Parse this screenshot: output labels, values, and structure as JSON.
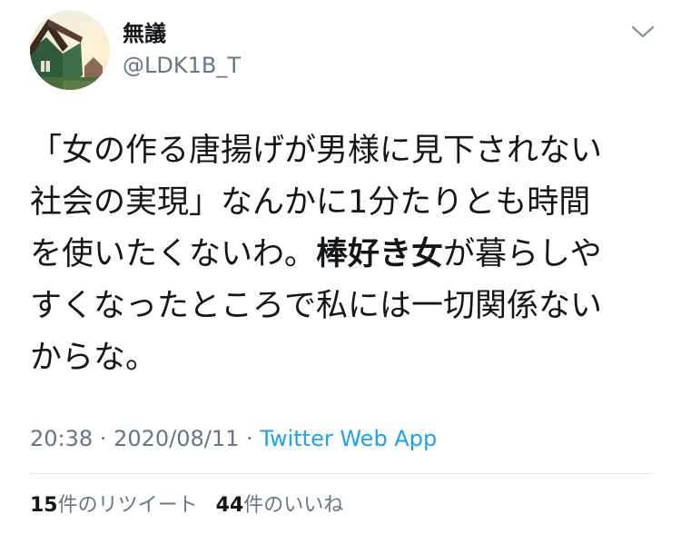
{
  "colors": {
    "text": "#14171a",
    "secondary": "#657786",
    "link": "#1da1f2",
    "divider": "#e1e8ed"
  },
  "user": {
    "display_name": "無議",
    "handle": "@LDK1B_T",
    "avatar_icon": "avatar-image"
  },
  "menu_icon": "chevron-down-icon",
  "tweet": {
    "lines": [
      {
        "text": "「女の作る唐揚げが男様に見下されない"
      },
      {
        "text": "社会の実現」なんかに1分たりとも時間"
      },
      {
        "pre": "を使いたくないわ。",
        "bold": "棒好き女",
        "post": "が暮らしや"
      },
      {
        "text": "すくなったところで私には一切関係ない"
      },
      {
        "text": "からな。"
      }
    ]
  },
  "meta": {
    "time": "20:38",
    "sep1": " · ",
    "date": "2020/08/11",
    "sep2": " · ",
    "source": "Twitter Web App"
  },
  "stats": {
    "retweets_count": "15",
    "retweets_label": "件のリツイート",
    "likes_count": "44",
    "likes_label": "件のいいね"
  }
}
